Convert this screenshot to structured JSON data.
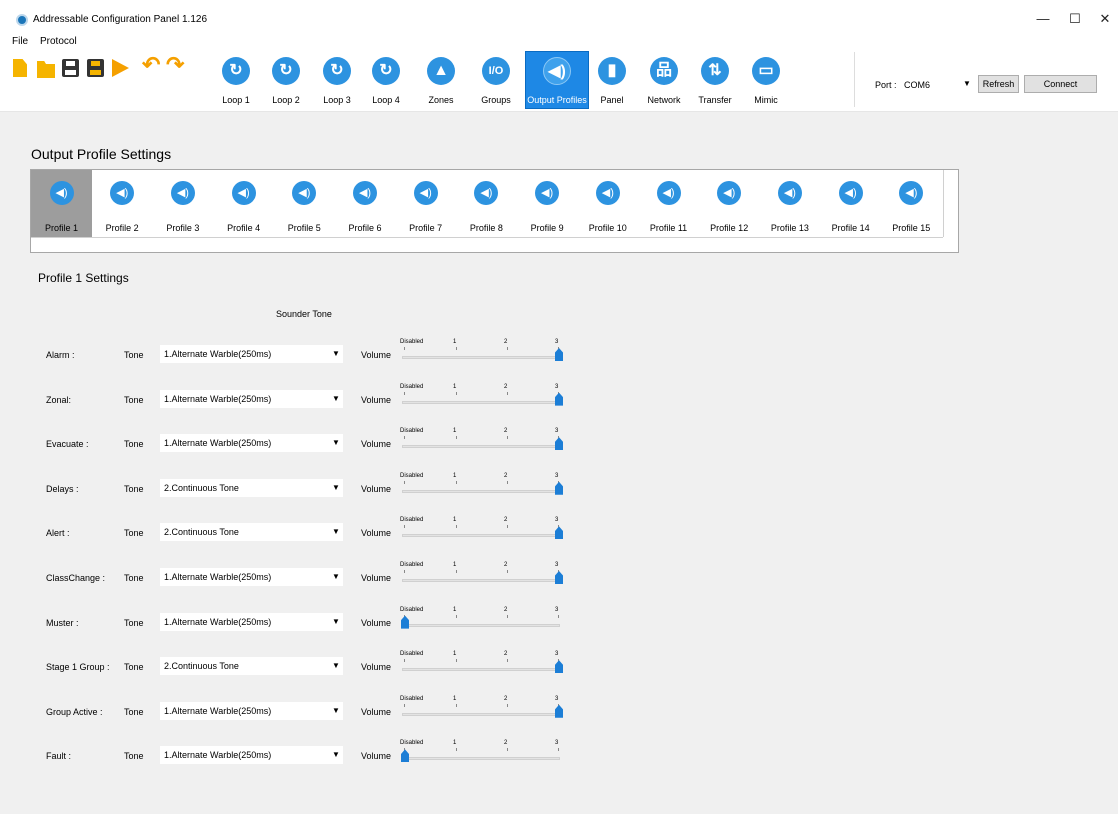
{
  "window": {
    "title": "Addressable Configuration Panel 1.126",
    "minimize": "—",
    "maximize": "☐",
    "close": "✕"
  },
  "menu": [
    "File",
    "Protocol"
  ],
  "toolbar": {
    "icons": [
      "new-document-icon",
      "open-folder-icon",
      "save-icon",
      "save-as-icon",
      "upload-icon",
      "undo-icon",
      "redo-icon"
    ],
    "nav": [
      {
        "label": "Loop 1",
        "icon": "loop-icon",
        "glyph": "↻"
      },
      {
        "label": "Loop 2",
        "icon": "loop-icon",
        "glyph": "↻"
      },
      {
        "label": "Loop 3",
        "icon": "loop-icon",
        "glyph": "↻"
      },
      {
        "label": "Loop 4",
        "icon": "loop-icon",
        "glyph": "↻"
      },
      {
        "label": "Zones",
        "icon": "zones-icon",
        "glyph": "▲"
      },
      {
        "label": "Groups",
        "icon": "groups-icon",
        "glyph": "I/O"
      },
      {
        "label": "Output Profiles",
        "icon": "speaker-icon",
        "glyph": "◀)"
      },
      {
        "label": "Panel",
        "icon": "panel-icon",
        "glyph": "▮"
      },
      {
        "label": "Network",
        "icon": "network-icon",
        "glyph": "品"
      },
      {
        "label": "Transfer",
        "icon": "transfer-icon",
        "glyph": "⇅"
      },
      {
        "label": "Mimic",
        "icon": "mimic-icon",
        "glyph": "▭"
      }
    ],
    "active_nav": "Output Profiles",
    "port_label": "Port :",
    "port_value": "COM6",
    "refresh_label": "Refresh",
    "connect_label": "Connect"
  },
  "main": {
    "section_title": "Output Profile Settings",
    "profiles": [
      "Profile 1",
      "Profile 2",
      "Profile 3",
      "Profile 4",
      "Profile 5",
      "Profile 6",
      "Profile 7",
      "Profile 8",
      "Profile 9",
      "Profile 10",
      "Profile 11",
      "Profile 12",
      "Profile 13",
      "Profile 14",
      "Profile 15"
    ],
    "selected_profile": "Profile 1",
    "settings_title": "Profile 1 Settings",
    "column_header": "Sounder Tone",
    "tone_label": "Tone",
    "volume_label": "Volume",
    "volume_ticks": [
      "Disabled",
      "1",
      "2",
      "3"
    ],
    "rows": [
      {
        "label": "Alarm :",
        "tone": "1.Alternate Warble(250ms)",
        "volume": 3
      },
      {
        "label": "Zonal:",
        "tone": "1.Alternate Warble(250ms)",
        "volume": 3
      },
      {
        "label": "Evacuate :",
        "tone": "1.Alternate Warble(250ms)",
        "volume": 3
      },
      {
        "label": "Delays :",
        "tone": "2.Continuous Tone",
        "volume": 3
      },
      {
        "label": "Alert :",
        "tone": "2.Continuous Tone",
        "volume": 3
      },
      {
        "label": "ClassChange :",
        "tone": "1.Alternate Warble(250ms)",
        "volume": 3
      },
      {
        "label": "Muster :",
        "tone": "1.Alternate Warble(250ms)",
        "volume": 0
      },
      {
        "label": "Stage 1 Group :",
        "tone": "2.Continuous Tone",
        "volume": 3
      },
      {
        "label": "Group Active :",
        "tone": "1.Alternate Warble(250ms)",
        "volume": 3
      },
      {
        "label": "Fault :",
        "tone": "1.Alternate Warble(250ms)",
        "volume": 0
      }
    ]
  }
}
